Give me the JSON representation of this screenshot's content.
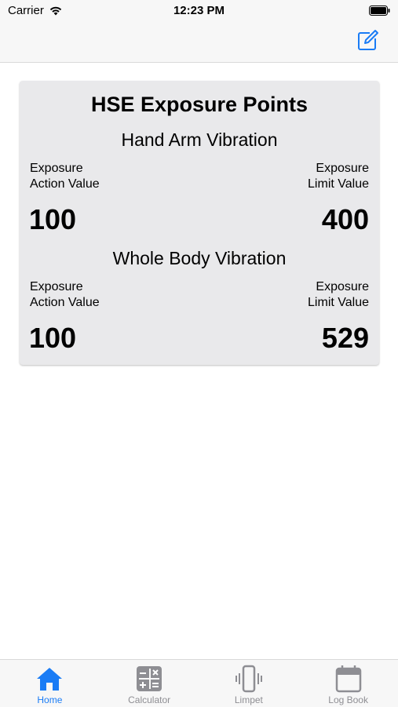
{
  "status_bar": {
    "carrier": "Carrier",
    "time": "12:23 PM"
  },
  "card": {
    "title": "HSE Exposure Points",
    "sections": [
      {
        "title": "Hand Arm Vibration",
        "left_label_line1": "Exposure",
        "left_label_line2": "Action Value",
        "right_label_line1": "Exposure",
        "right_label_line2": "Limit Value",
        "action_value": "100",
        "limit_value": "400"
      },
      {
        "title": "Whole Body Vibration",
        "left_label_line1": "Exposure",
        "left_label_line2": "Action Value",
        "right_label_line1": "Exposure",
        "right_label_line2": "Limit Value",
        "action_value": "100",
        "limit_value": "529"
      }
    ]
  },
  "tab_bar": {
    "tabs": [
      {
        "label": "Home",
        "icon": "home-icon",
        "active": true
      },
      {
        "label": "Calculator",
        "icon": "calculator-icon",
        "active": false
      },
      {
        "label": "Limpet",
        "icon": "vibration-icon",
        "active": false
      },
      {
        "label": "Log Book",
        "icon": "calendar-icon",
        "active": false
      }
    ]
  },
  "colors": {
    "accent": "#1a7cf5",
    "inactive": "#8e8e93",
    "card_bg": "#e9e9eb",
    "bar_bg": "#f7f7f7"
  }
}
